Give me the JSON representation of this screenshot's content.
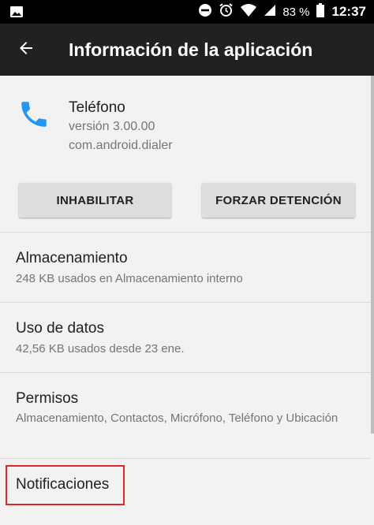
{
  "status_bar": {
    "battery_percent": "83 %",
    "time": "12:37",
    "icons": [
      "image-icon",
      "do-not-disturb-icon",
      "alarm-icon",
      "wifi-icon",
      "signal-icon",
      "battery-icon"
    ]
  },
  "app_bar": {
    "title": "Información de la aplicación",
    "back_icon": "arrow-back-icon"
  },
  "app": {
    "name": "Teléfono",
    "version": "versión 3.00.00",
    "package": "com.android.dialer",
    "icon": "phone-icon",
    "icon_color": "#2196F3"
  },
  "buttons": {
    "disable_label": "INHABILITAR",
    "force_stop_label": "FORZAR DETENCIÓN"
  },
  "sections": {
    "storage": {
      "title": "Almacenamiento",
      "subtitle": "248 KB usados en Almacenamiento interno"
    },
    "data_usage": {
      "title": "Uso de datos",
      "subtitle": "42,56 KB usados desde 23 ene."
    },
    "permissions": {
      "title": "Permisos",
      "subtitle": "Almacenamiento, Contactos, Micrófono, Teléfono y Ubicación"
    },
    "notifications": {
      "title": "Notificaciones"
    }
  },
  "colors": {
    "status_bar": "#000000",
    "app_bar": "#212121",
    "background": "#F2F2F2",
    "highlight": "#E0272F"
  }
}
